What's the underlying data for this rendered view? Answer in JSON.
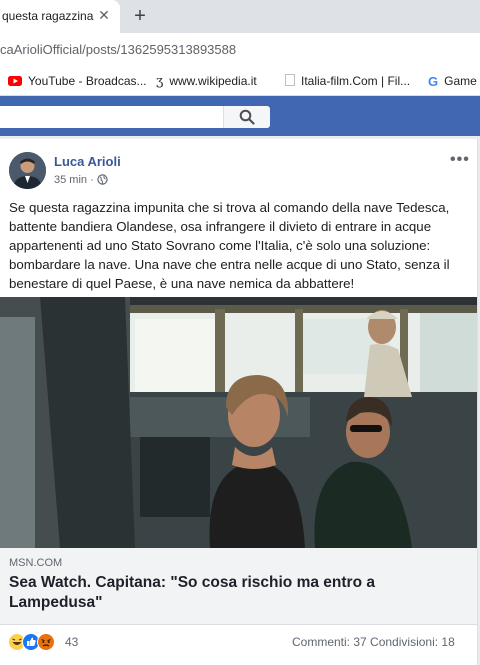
{
  "browser": {
    "tab_title": "questa ragazzina",
    "url": "caArioliOfficial/posts/1362595313893588",
    "bookmarks": [
      {
        "label": "YouTube - Broadcas...",
        "icon": "youtube-icon"
      },
      {
        "label": "www.wikipedia.it",
        "icon": "wikipedia-icon"
      },
      {
        "label": "Italia-film.Com | Fil...",
        "icon": "page-icon"
      },
      {
        "label": "Game",
        "icon": "google-icon"
      }
    ]
  },
  "post": {
    "author": "Luca Arioli",
    "time": "35 min",
    "text": "Se questa ragazzina impunita che si trova al comando della nave Tedesca, battente bandiera Olandese, osa infrangere il divieto di entrare in acque appartenenti ad uno Stato Sovrano come l'Italia, c'è solo una soluzione: bombardare la nave. Una nave che entra nelle acque di uno Stato, senza il benestare di quel Paese, è una nave nemica da abbattere!",
    "link": {
      "domain": "MSN.COM",
      "title": "Sea Watch. Capitana: \"So cosa rischio ma entro a Lampedusa\""
    },
    "reactions_count": "43",
    "comments": "Commenti: 37",
    "shares": "Condivisioni: 18"
  },
  "colors": {
    "facebook_blue": "#4267b2",
    "author_link": "#385898"
  }
}
